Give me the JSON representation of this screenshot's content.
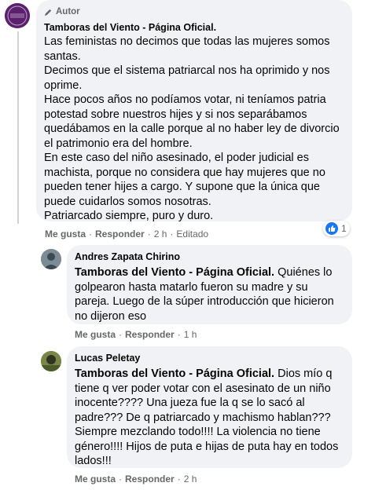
{
  "comments": [
    {
      "badge": "Autor",
      "author": "Tamboras del Viento - Página Oficial.",
      "avatar_caption": "Tamboras del Viento",
      "body": "Las feministas no decimos que todas las mujeres somos santas.\nDecimos que el sistema patriarcal nos ha oprimido y nos oprime.\nHace pocos años no podíamos votar, ni teníamos patria potestad sobre nuestros hijes y si nos separábamos quedábamos en la calle porque al no haber ley de divorcio el patrimonio era del hombre.\nEn este caso del niño asesinado, el poder judicial es machista, porque no considera que hay mujeres que no pueden tener hijes a cargo. Y supone que la única que puede cuidarlos somos nosotras.\nPatriarcado siempre, puro y duro.",
      "actions": {
        "like": "Me gusta",
        "reply": "Responder",
        "time": "2 h",
        "edited": "Editado"
      },
      "reaction_count": "1"
    },
    {
      "author": "Andres Zapata Chirino",
      "tag": "Tamboras del Viento - Página Oficial.",
      "body": " Quiénes lo golpearon hasta matarlo fueron su madre y su pareja. Luego de la súper introducción que hicieron no dijeron eso",
      "actions": {
        "like": "Me gusta",
        "reply": "Responder",
        "time": "1 h"
      }
    },
    {
      "author": "Lucas Peletay",
      "tag": "Tamboras del Viento - Página Oficial.",
      "body": " Dios mío q tiene q ver poder votar con el asesinato de un niño inocente???? Una jueza fue la q se lo sacó al padre??? De q patriarcado y machismo hablan??? Siempre mezclando todo!!!! La violencia no tiene género!!!! Hijos de puta e hijas de puta hay en todos lados!!!",
      "actions": {
        "like": "Me gusta",
        "reply": "Responder",
        "time": "2 h"
      }
    }
  ],
  "colors": {
    "bubble": "#f0f2f5",
    "meta": "#65676b",
    "like_blue": "#1877f2",
    "avatar_purple": "#5b1f6e"
  }
}
